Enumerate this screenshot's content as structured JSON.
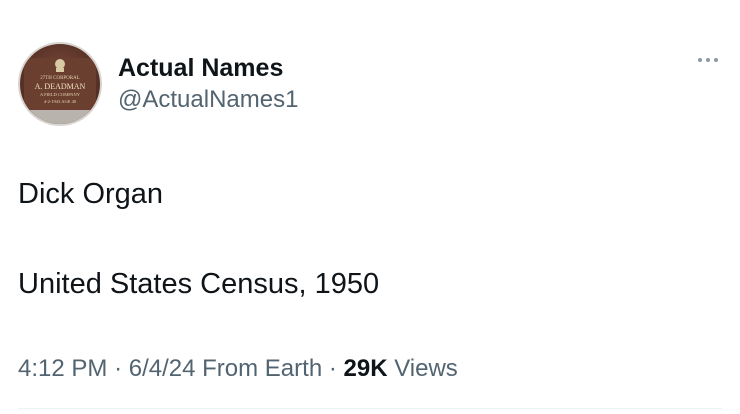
{
  "tweet": {
    "author": {
      "display_name": "Actual Names",
      "handle": "@ActualNames1",
      "avatar": {
        "description": "bronze name plaque",
        "plaque_lines": [
          "27TH CORPORAL",
          "A. DEADMAN",
          "A FIELD COMPANY",
          "4-2-1943 AGE 40"
        ]
      }
    },
    "more_icon": "more-dots-icon",
    "text_lines": [
      "Dick Organ",
      "United States Census, 1950"
    ],
    "meta": {
      "time": "4:12 PM",
      "separator": "·",
      "date": "6/4/24",
      "source": "From Earth",
      "views_count": "29K",
      "views_label": "Views"
    }
  }
}
